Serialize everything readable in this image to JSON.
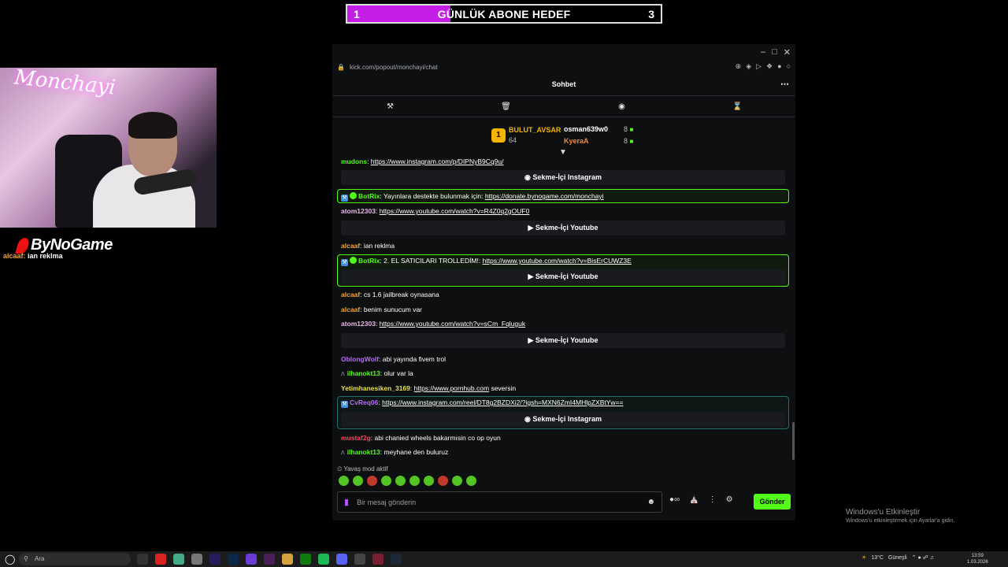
{
  "goal": {
    "current": "1",
    "title": "GÜNLÜK ABONE HEDEF",
    "target": "3",
    "progress": 0.33,
    "fill_color": "#c41ee6"
  },
  "webcam": {
    "neon_text": "Monchayi"
  },
  "brand": {
    "name": "ByNoGame"
  },
  "overlay_message": {
    "user": "alcaaf:",
    "text": "ian reklma"
  },
  "browser": {
    "url": "kick.com/popout/monchayi/chat"
  },
  "chat": {
    "title": "Sohbet",
    "leaderboard": {
      "rank1_name": "BULUT_AVSAR",
      "rank1_count": "64",
      "rank2_name": "osman639w0",
      "rank2_count": "8",
      "rank3_name": "KyeraA",
      "rank3_count": "8"
    },
    "messages": {
      "m0_user": "mudons",
      "m0_link": "https://www.instagram.com/p/DIPNyB9Cq9u/",
      "e0": "Sekme-İçi Instagram",
      "m1_user": "BotRix",
      "m1_text": "Yayınlara destekte bulunmak için:",
      "m1_link": "https://donate.bynogame.com/monchayi",
      "m2_user": "atom12303",
      "m2_link": "https://www.youtube.com/watch?v=R4Z0q2gOUF0",
      "e1": "Sekme-İçi Youtube",
      "m3_user": "alcaaf",
      "m3_text": "ian reklma",
      "m4_user": "BotRix",
      "m4_text": "2. EL SATICILARI TROLLEDİM!:",
      "m4_link": "https://www.youtube.com/watch?v=BisErCUWZ3E",
      "e2": "Sekme-İçi Youtube",
      "m5_user": "alcaaf",
      "m5_text": "cs 1.6 jailbreak oynasana",
      "m6_user": "alcaaf",
      "m6_text": "benim sunucum var",
      "m7_user": "atom12303",
      "m7_link": "https://www.youtube.com/watch?v=sCm_Fqluguk",
      "e3": "Sekme-İçi Youtube",
      "m8_user": "OblongWolf",
      "m8_text": "abi yayında fivem trol",
      "m9_user": "ilhanokt13",
      "m9_text": "olur var la",
      "m10_user": "Yetimhanesiken_3169",
      "m10_link": "https://www.pornhub.com",
      "m10_text": "seversin",
      "m11_user": "CvReq06",
      "m11_link": "https://www.instagram.com/reel/DT8g2BZDXi2/?igsh=MXN6ZmI4MHlpZXBtYw==",
      "e4": "Sekme-İçi Instagram",
      "m12_user": "mustaf2g",
      "m12_text": "abi chanied wheels bakarmısin co op oyun",
      "m13_user": "ilhanokt13",
      "m13_text": "meyhane den buluruz"
    },
    "slow_mode": "Yavaş mod aktif",
    "input_placeholder": "Bir mesaj gönderin",
    "send_label": "Gönder"
  },
  "watermark": {
    "line1": "Windows'u Etkinleştir",
    "line2": "Windows'u etkinleştirmek için Ayarlar'a gidin."
  },
  "taskbar": {
    "search_placeholder": "Ara",
    "weather": "13°C",
    "weather_text": "Güneşli",
    "time": "13:59",
    "date": "1.03.2026"
  },
  "colors": {
    "kick_green": "#53fc18",
    "goal_purple": "#c41ee6"
  }
}
